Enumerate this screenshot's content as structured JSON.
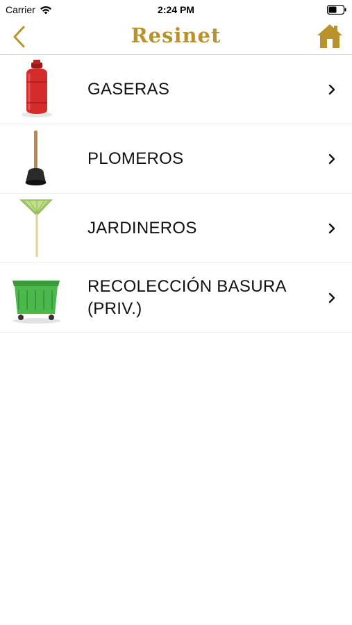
{
  "status_bar": {
    "carrier": "Carrier",
    "time": "2:24 PM"
  },
  "nav": {
    "logo": "Resinet",
    "back_icon": "chevron-left-icon",
    "home_icon": "home-icon",
    "accent_color": "#b8922a"
  },
  "items": [
    {
      "label": "GASERAS",
      "icon": "gas-cylinder-icon"
    },
    {
      "label": "PLOMEROS",
      "icon": "plunger-icon"
    },
    {
      "label": "JARDINEROS",
      "icon": "rake-icon"
    },
    {
      "label": "RECOLECCIÓN BASURA (PRIV.)",
      "icon": "garbage-bin-icon"
    }
  ]
}
